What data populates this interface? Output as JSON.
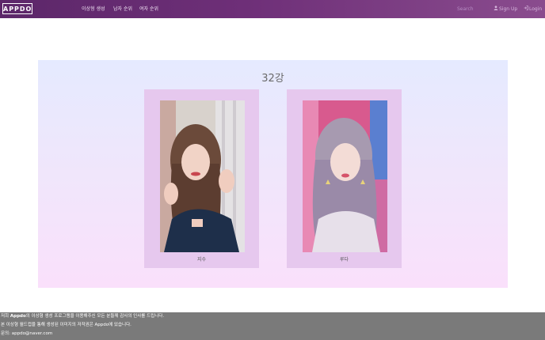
{
  "navbar": {
    "brand": "APPDO",
    "links": [
      "이상형 생성",
      "남자 순위",
      "여자 순위"
    ],
    "search_placeholder": "Search",
    "signup_label": "Sign Up",
    "login_label": "Login"
  },
  "main": {
    "round_title": "32강",
    "candidates": [
      {
        "name": "지수"
      },
      {
        "name": "루다"
      }
    ]
  },
  "footer": {
    "line1_prefix": "저희 ",
    "line1_brand": "Appdo",
    "line1_suffix": "의 이상형 생성 프로그램을 이용해주신 모든 분들께 감사의 인사를 드립니다.",
    "line2": "본 이상형 월드컵을 통해 생성된 이미지의 저작권은 Appdo에 있습니다.",
    "line3": "문의: appdo@naver.com"
  },
  "colors": {
    "navbar": "#6e2f78",
    "card": "#e6c8ee",
    "footer": "#7a7a7a"
  }
}
